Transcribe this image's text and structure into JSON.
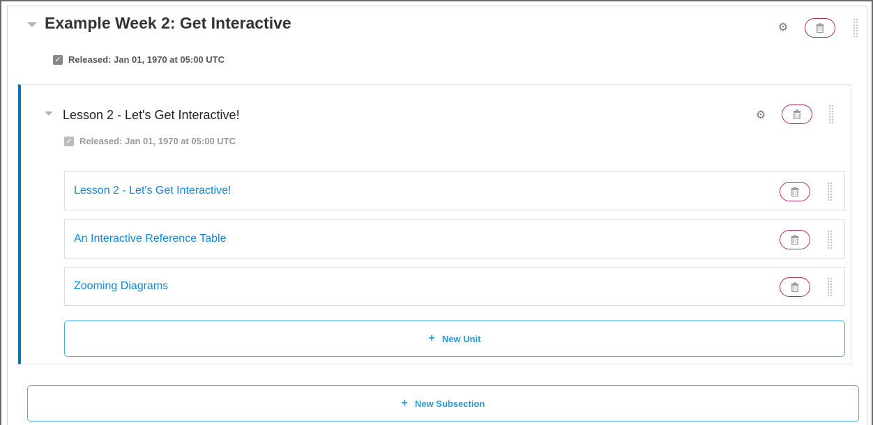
{
  "section": {
    "title": "Example Week 2: Get Interactive",
    "released": "Released: Jan 01, 1970 at 05:00 UTC"
  },
  "subsection": {
    "title": "Lesson 2 - Let's Get Interactive!",
    "released": "Released: Jan 01, 1970 at 05:00 UTC"
  },
  "units": [
    {
      "title": "Lesson 2 - Let's Get Interactive!"
    },
    {
      "title": "An Interactive Reference Table"
    },
    {
      "title": "Zooming Diagrams"
    }
  ],
  "buttons": {
    "new_unit": "New Unit",
    "new_subsection": "New Subsection",
    "plus": "+"
  },
  "icons": {
    "settings": "gear-icon",
    "delete": "trash-icon",
    "drag": "drag-handle-icon",
    "collapse": "collapse-triangle-icon",
    "check": "checkbox-icon"
  },
  "colors": {
    "accent": "#0075b4",
    "link": "#0e88d9",
    "delete_outline": "#b52a5e",
    "add_border": "#4ab0e4"
  }
}
